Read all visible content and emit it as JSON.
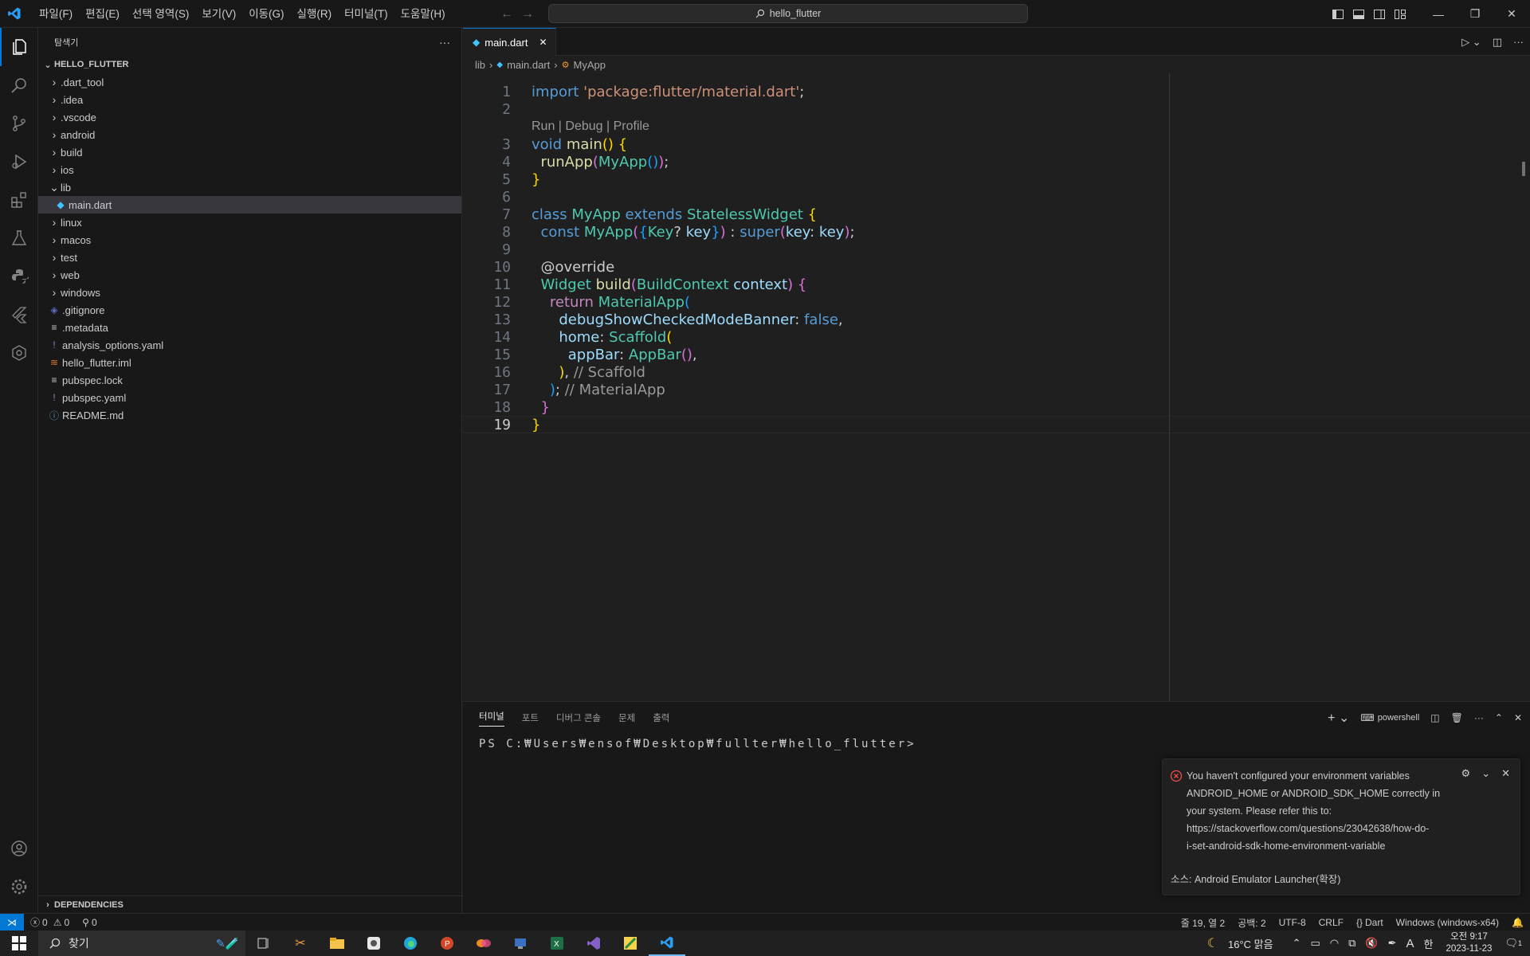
{
  "titlebar": {
    "menus": [
      "파일(F)",
      "편집(E)",
      "선택 영역(S)",
      "보기(V)",
      "이동(G)",
      "실행(R)",
      "터미널(T)",
      "도움말(H)"
    ],
    "search": "hello_flutter"
  },
  "sidebar": {
    "title": "탐색기",
    "project": "HELLO_FLUTTER",
    "items": [
      {
        "label": ".dart_tool",
        "type": "folder",
        "expanded": false,
        "depth": 0
      },
      {
        "label": ".idea",
        "type": "folder",
        "expanded": false,
        "depth": 0
      },
      {
        "label": ".vscode",
        "type": "folder",
        "expanded": false,
        "depth": 0
      },
      {
        "label": "android",
        "type": "folder",
        "expanded": false,
        "depth": 0
      },
      {
        "label": "build",
        "type": "folder",
        "expanded": false,
        "depth": 0
      },
      {
        "label": "ios",
        "type": "folder",
        "expanded": false,
        "depth": 0
      },
      {
        "label": "lib",
        "type": "folder",
        "expanded": true,
        "depth": 0
      },
      {
        "label": "main.dart",
        "type": "dart",
        "depth": 1,
        "selected": true
      },
      {
        "label": "linux",
        "type": "folder",
        "expanded": false,
        "depth": 0
      },
      {
        "label": "macos",
        "type": "folder",
        "expanded": false,
        "depth": 0
      },
      {
        "label": "test",
        "type": "folder",
        "expanded": false,
        "depth": 0
      },
      {
        "label": "web",
        "type": "folder",
        "expanded": false,
        "depth": 0
      },
      {
        "label": "windows",
        "type": "folder",
        "expanded": false,
        "depth": 0
      },
      {
        "label": ".gitignore",
        "type": "git",
        "depth": 0
      },
      {
        "label": ".metadata",
        "type": "text",
        "depth": 0
      },
      {
        "label": "analysis_options.yaml",
        "type": "yaml",
        "depth": 0
      },
      {
        "label": "hello_flutter.iml",
        "type": "rss",
        "depth": 0
      },
      {
        "label": "pubspec.lock",
        "type": "text",
        "depth": 0
      },
      {
        "label": "pubspec.yaml",
        "type": "yaml",
        "depth": 0
      },
      {
        "label": "README.md",
        "type": "info",
        "depth": 0
      }
    ],
    "dependencies": "DEPENDENCIES"
  },
  "editor": {
    "tab": "main.dart",
    "breadcrumb": [
      "lib",
      "main.dart",
      "MyApp"
    ],
    "codelens": "Run | Debug | Profile",
    "lines": [
      {
        "n": "1",
        "tokens": [
          [
            "import ",
            "#569cd6"
          ],
          [
            "'package:flutter/material.dart'",
            "#ce9178"
          ],
          [
            ";",
            "#cccccc"
          ]
        ]
      },
      {
        "n": "2",
        "tokens": []
      },
      {
        "n": "3",
        "tokens": [
          [
            "void ",
            "#569cd6"
          ],
          [
            "main",
            "#dcdcaa"
          ],
          [
            "() ",
            "#ffd700"
          ],
          [
            "{",
            "#ffd700"
          ]
        ]
      },
      {
        "n": "4",
        "tokens": [
          [
            "  runApp",
            "#dcdcaa"
          ],
          [
            "(",
            "#da70d6"
          ],
          [
            "MyApp",
            "#4ec9b0"
          ],
          [
            "()",
            "#179fff"
          ],
          [
            ")",
            "#da70d6"
          ],
          [
            ";",
            "#cccccc"
          ]
        ]
      },
      {
        "n": "5",
        "tokens": [
          [
            "}",
            "#ffd700"
          ]
        ]
      },
      {
        "n": "6",
        "tokens": []
      },
      {
        "n": "7",
        "tokens": [
          [
            "class ",
            "#569cd6"
          ],
          [
            "MyApp ",
            "#4ec9b0"
          ],
          [
            "extends ",
            "#569cd6"
          ],
          [
            "StatelessWidget ",
            "#4ec9b0"
          ],
          [
            "{",
            "#ffd700"
          ]
        ]
      },
      {
        "n": "8",
        "tokens": [
          [
            "  const ",
            "#569cd6"
          ],
          [
            "MyApp",
            "#4ec9b0"
          ],
          [
            "(",
            "#da70d6"
          ],
          [
            "{",
            "#179fff"
          ],
          [
            "Key",
            "#4ec9b0"
          ],
          [
            "? ",
            "#cccccc"
          ],
          [
            "key",
            "#9cdcfe"
          ],
          [
            "}",
            "#179fff"
          ],
          [
            ")",
            "#da70d6"
          ],
          [
            " : ",
            "#cccccc"
          ],
          [
            "super",
            "#569cd6"
          ],
          [
            "(",
            "#da70d6"
          ],
          [
            "key",
            "#9cdcfe"
          ],
          [
            ": ",
            "#cccccc"
          ],
          [
            "key",
            "#9cdcfe"
          ],
          [
            ")",
            "#da70d6"
          ],
          [
            ";",
            "#cccccc"
          ]
        ]
      },
      {
        "n": "9",
        "tokens": []
      },
      {
        "n": "10",
        "tokens": [
          [
            "  @override",
            "#cccccc"
          ]
        ]
      },
      {
        "n": "11",
        "tokens": [
          [
            "  Widget ",
            "#4ec9b0"
          ],
          [
            "build",
            "#dcdcaa"
          ],
          [
            "(",
            "#da70d6"
          ],
          [
            "BuildContext ",
            "#4ec9b0"
          ],
          [
            "context",
            "#9cdcfe"
          ],
          [
            ") ",
            "#da70d6"
          ],
          [
            "{",
            "#da70d6"
          ]
        ]
      },
      {
        "n": "12",
        "tokens": [
          [
            "    return ",
            "#c586c0"
          ],
          [
            "MaterialApp",
            "#4ec9b0"
          ],
          [
            "(",
            "#179fff"
          ]
        ]
      },
      {
        "n": "13",
        "tokens": [
          [
            "      debugShowCheckedModeBanner",
            "#9cdcfe"
          ],
          [
            ": ",
            "#cccccc"
          ],
          [
            "false",
            "#569cd6"
          ],
          [
            ",",
            "#cccccc"
          ]
        ]
      },
      {
        "n": "14",
        "tokens": [
          [
            "      home",
            "#9cdcfe"
          ],
          [
            ": ",
            "#cccccc"
          ],
          [
            "Scaffold",
            "#4ec9b0"
          ],
          [
            "(",
            "#ffd700"
          ]
        ]
      },
      {
        "n": "15",
        "tokens": [
          [
            "        appBar",
            "#9cdcfe"
          ],
          [
            ": ",
            "#cccccc"
          ],
          [
            "AppBar",
            "#4ec9b0"
          ],
          [
            "()",
            "#da70d6"
          ],
          [
            ",",
            "#cccccc"
          ]
        ]
      },
      {
        "n": "16",
        "tokens": [
          [
            "      ",
            "#cccccc"
          ],
          [
            ")",
            "#ffd700"
          ],
          [
            ", ",
            "#cccccc"
          ],
          [
            "// Scaffold",
            "#999999"
          ]
        ]
      },
      {
        "n": "17",
        "tokens": [
          [
            "    ",
            "#cccccc"
          ],
          [
            ")",
            "#179fff"
          ],
          [
            "; ",
            "#cccccc"
          ],
          [
            "// MaterialApp",
            "#999999"
          ]
        ]
      },
      {
        "n": "18",
        "tokens": [
          [
            "  ",
            "#cccccc"
          ],
          [
            "}",
            "#da70d6"
          ]
        ]
      },
      {
        "n": "19",
        "tokens": [
          [
            "}",
            "#ffd700"
          ]
        ]
      }
    ]
  },
  "panel": {
    "tabs": [
      "터미널",
      "포트",
      "디버그 콘솔",
      "문제",
      "출력"
    ],
    "shell": "powershell",
    "prompt": "PS C:₩Users₩ensof₩Desktop₩fullter₩hello_flutter>"
  },
  "notification": {
    "message_lines": [
      "You haven't configured your environment variables",
      "ANDROID_HOME or ANDROID_SDK_HOME correctly in",
      "your system. Please refer this to:",
      "https://stackoverflow.com/questions/23042638/how-do-",
      "i-set-android-sdk-home-environment-variable"
    ],
    "source": "소스: Android Emulator Launcher(확장)"
  },
  "statusbar": {
    "errors": "0",
    "warnings": "0",
    "ports": "0",
    "position": "줄 19, 열 2",
    "spaces": "공백: 2",
    "encoding": "UTF-8",
    "eol": "CRLF",
    "language": "Dart",
    "platform": "Windows (windows-x64)"
  },
  "taskbar": {
    "search": "찾기",
    "weather": "16°C 맑음",
    "time": "오전 9:17",
    "date": "2023-11-23",
    "ime": "한",
    "font_a": "A",
    "notif_count": "1"
  },
  "colors": {
    "accent": "#0078d4",
    "bg": "#1f1f1f",
    "sidebar": "#181818",
    "error": "#f14c4c"
  }
}
